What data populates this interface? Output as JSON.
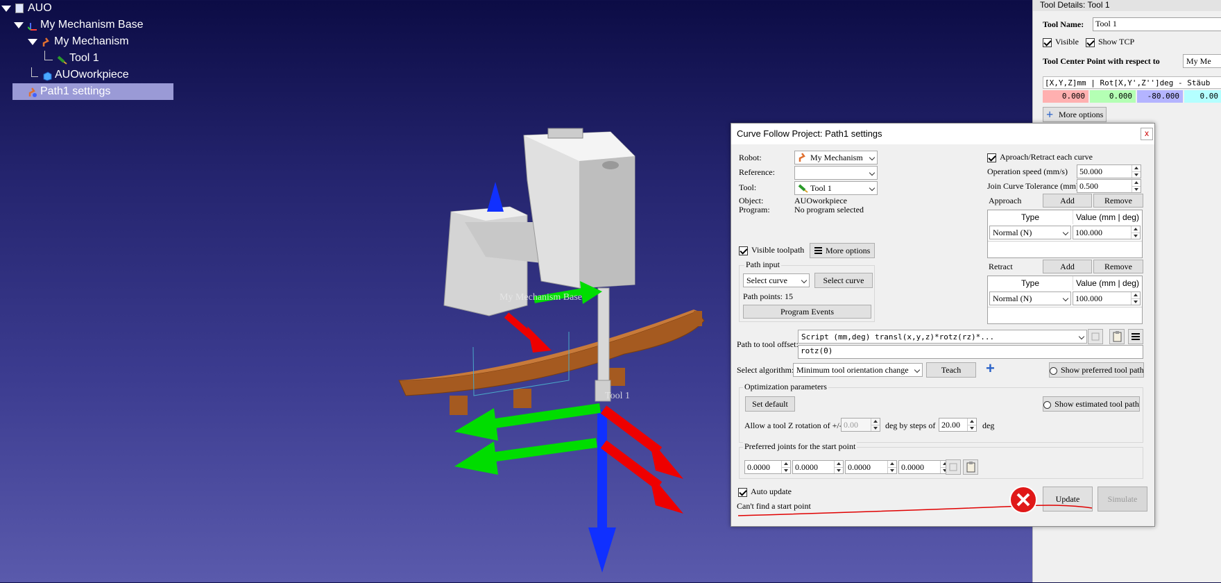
{
  "tree": {
    "root": "AUO",
    "base": "My Mechanism Base",
    "mechanism": "My Mechanism",
    "tool": "Tool 1",
    "workpiece": "AUOworkpiece",
    "path_settings": "Path1 settings"
  },
  "scene": {
    "base_label": "My Mechanism Base",
    "tool_label": "Tool 1"
  },
  "tool_panel": {
    "title": "Tool Details: Tool 1",
    "name_label": "Tool Name:",
    "name_value": "Tool 1",
    "visible_label": "Visible",
    "show_tcp_label": "Show TCP",
    "tcp_label": "Tool Center Point with respect to",
    "tcp_ref": "My Me",
    "format": "[X,Y,Z]mm | Rot[X,Y',Z'']deg - Stäub",
    "values": [
      "0.000",
      "0.000",
      "-80.000",
      "0.00"
    ],
    "more_options": "More options",
    "colors": {
      "x": "#ffb0b0",
      "y": "#b4ffb4",
      "z": "#b4b4ff",
      "rx": "#b4ffff"
    }
  },
  "dialog": {
    "title": "Curve Follow Project: Path1 settings",
    "close": "x",
    "robot_label": "Robot:",
    "robot_value": "My Mechanism",
    "reference_label": "Reference:",
    "reference_value": "",
    "tool_label": "Tool:",
    "tool_value": "Tool 1",
    "object_label": "Object:",
    "object_value": "AUOworkpiece",
    "program_label": "Program:",
    "program_value": "No program selected",
    "approach_retract_each": "Aproach/Retract each curve",
    "op_speed_label": "Operation speed (mm/s)",
    "op_speed_value": "50.000",
    "join_tol_label": "Join Curve Tolerance (mm)",
    "join_tol_value": "0.500",
    "approach_label": "Approach",
    "retract_label": "Retract",
    "add_label": "Add",
    "remove_label": "Remove",
    "col_type": "Type",
    "col_value": "Value (mm | deg)",
    "approach_row": {
      "type": "Normal (N)",
      "value": "100.000"
    },
    "retract_row": {
      "type": "Normal (N)",
      "value": "100.000"
    },
    "visible_toolpath": "Visible toolpath",
    "more_options": "More options",
    "path_input": "Path input",
    "select_curve_combo": "Select curve",
    "select_curve_btn": "Select curve",
    "path_points": "Path points: 15",
    "program_events": "Program Events",
    "path_offset_label": "Path to tool offset:",
    "path_offset_combo": "Script (mm,deg) transl(x,y,z)*rotz(rz)*...",
    "path_offset_value": "rotz(0)",
    "algorithm_label": "Select algorithm:",
    "algorithm_value": "Minimum tool orientation change",
    "teach": "Teach",
    "show_preferred": "Show preferred tool path",
    "opt_params": "Optimization parameters",
    "set_default": "Set default",
    "show_estimated": "Show estimated tool path",
    "allow_rot_label": "Allow a tool Z rotation of +/-",
    "allow_rot_value": "0.00",
    "deg_by_steps": "deg by steps of",
    "steps_value": "20.00",
    "deg": "deg",
    "pref_joints": "Preferred joints for the start point",
    "joints": [
      "0.0000",
      "0.0000",
      "0.0000",
      "0.0000"
    ],
    "auto_update": "Auto update",
    "status": "Can't find a start point",
    "update": "Update",
    "simulate": "Simulate"
  }
}
